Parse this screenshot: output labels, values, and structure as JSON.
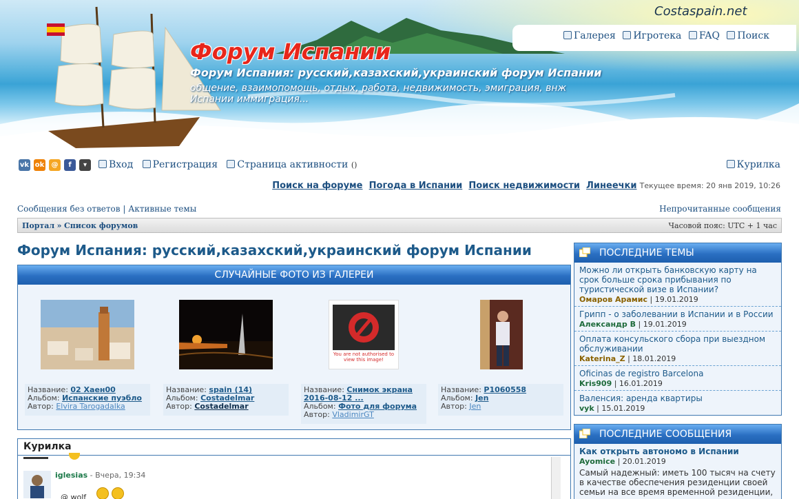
{
  "header": {
    "brand": "Costaspain.net",
    "title": "Форум Испании",
    "subtitle": "Форум Испания: русский,казахский,украинский форум Испании",
    "description": "общение, взаимопомощь, отдых, работа, недвижимость, эмиграция, внж Испании иммиграция...",
    "links": [
      {
        "label": "Галерея",
        "icon": "gallery-icon"
      },
      {
        "label": "Игротека",
        "icon": "games-icon"
      },
      {
        "label": "FAQ",
        "icon": "faq-icon"
      },
      {
        "label": "Поиск",
        "icon": "search-icon"
      }
    ]
  },
  "social": [
    {
      "name": "vk",
      "label": "vk",
      "color": "#4a76a8"
    },
    {
      "name": "odnoklassniki",
      "label": "ok",
      "color": "#ee8208"
    },
    {
      "name": "mail",
      "label": "@",
      "color": "#f5a623"
    },
    {
      "name": "facebook",
      "label": "f",
      "color": "#3b5998"
    },
    {
      "name": "more",
      "label": "▾",
      "color": "#444444"
    }
  ],
  "auth": {
    "login": "Вход",
    "register": "Регистрация",
    "activity": "Страница активности",
    "activity_count": "()",
    "chat": "Курилка"
  },
  "quick_links": {
    "search_forum": "Поиск на форуме",
    "weather": "Погода в Испании",
    "realty": "Поиск недвижимости",
    "lines": "Линеечки",
    "time": "Текущее время: 20 янв 2019, 10:26"
  },
  "sub_links": {
    "no_replies": "Сообщения без ответов",
    "active": "Активные темы",
    "unread": "Непрочитанные сообщения"
  },
  "breadcrumb": {
    "portal": "Портал",
    "separator": "»",
    "forums": "Список форумов",
    "timezone": "Часовой пояс: UTC + 1 час"
  },
  "main": {
    "title": "Форум Испания: русский,казахский,украинский форум Испании",
    "gallery_title": "СЛУЧАЙНЫЕ ФОТО ИЗ ГАЛЕРЕИ",
    "labels": {
      "name": "Название:",
      "album": "Альбом:",
      "author": "Автор:"
    },
    "photos": [
      {
        "name": "02 Хаен00",
        "album": "Испанские пуэбло",
        "author": "Elvira Tarogadalka"
      },
      {
        "name": "spain (14)",
        "album": "Costadelmar",
        "author": "Costadelmar"
      },
      {
        "name": "Снимок экрана 2016-08-12 ...",
        "album": "Фото для форума",
        "author": "VladimirGT",
        "blocked_text": "You are not authorised to view this image!"
      },
      {
        "name": "P1060558",
        "album": "Jen",
        "author": "Jen"
      }
    ]
  },
  "chat": {
    "title": "Курилка",
    "user": "iglesias",
    "time": "- Вчера, 19:34",
    "snippet": "@ wolf"
  },
  "sidebar": {
    "latest_topics_title": "ПОСЛЕДНИЕ ТЕМЫ",
    "topics": [
      {
        "title": "Можно ли открыть банковскую карту на срок больше срока прибывания по туристической визе в Испании?",
        "author": "Омаров Арамис",
        "date": "| 19.01.2019"
      },
      {
        "title": "Грипп - о заболевании в Испании и в России",
        "author": "Александр В",
        "date": "| 19.01.2019"
      },
      {
        "title": "Оплата консульского сбора при выездном обслуживании",
        "author": "Katerina_Z",
        "date": "| 18.01.2019"
      },
      {
        "title": "Oficinas de registro Barcelona",
        "author": "Kris909",
        "date": "| 16.01.2019"
      },
      {
        "title": "Валенсия: аренда квартиры",
        "author": "vyk",
        "date": "| 15.01.2019"
      }
    ],
    "latest_posts_title": "ПОСЛЕДНИЕ СООБЩЕНИЯ",
    "post": {
      "title": "Как открыть автономо в Испании",
      "author": "Ayomice",
      "date": "| 20.01.2019",
      "text": "Самый надежный: иметь 100 тысяч на счету в качестве обеспечения резиденции своей семьи на все время временной резиденции, ну, как"
    }
  }
}
